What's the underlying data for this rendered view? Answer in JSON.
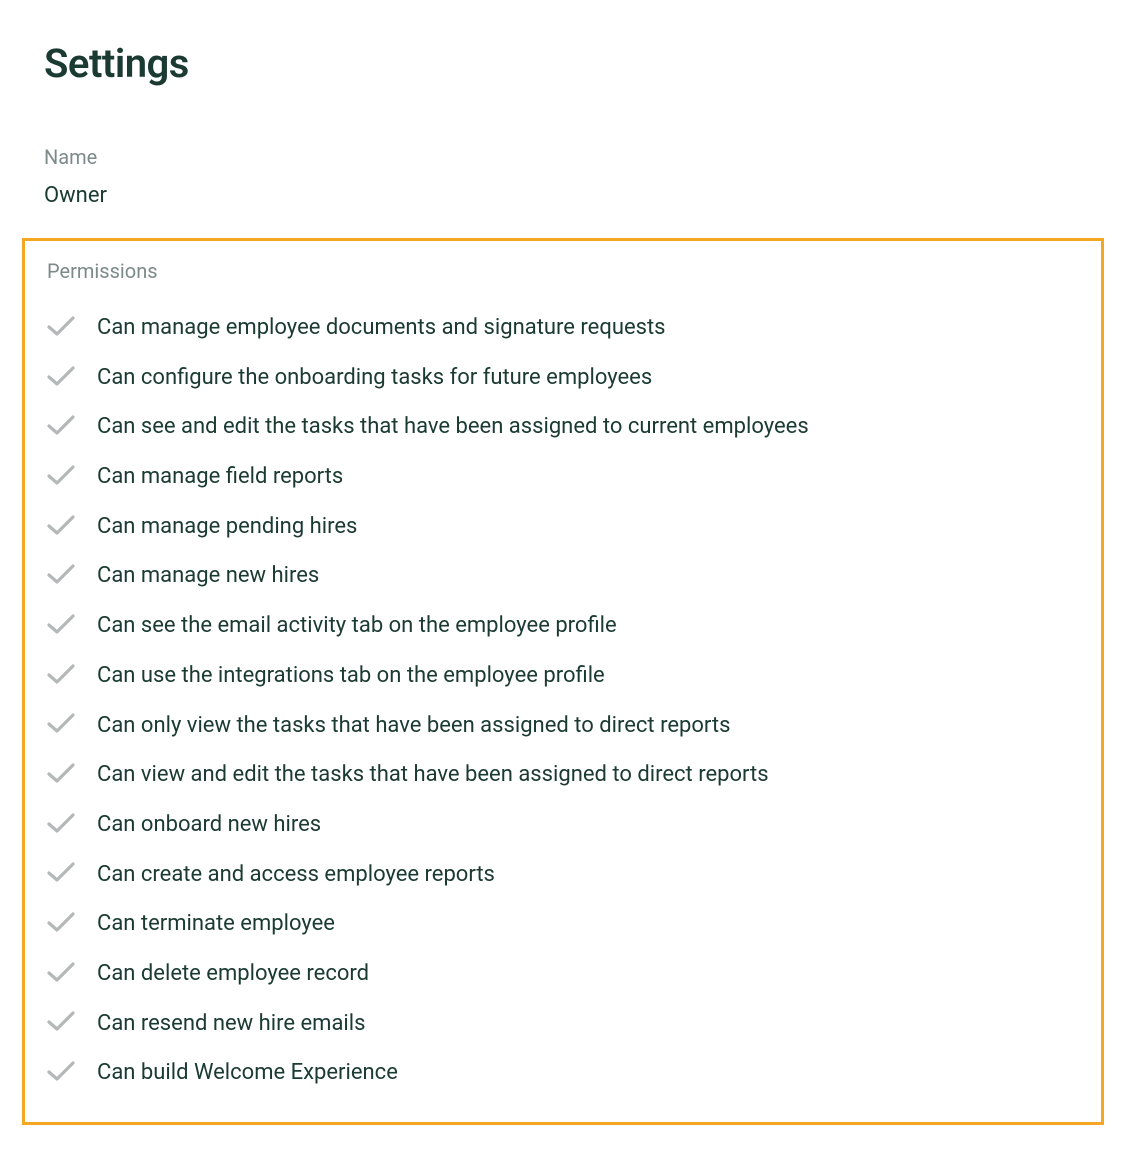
{
  "header": {
    "title": "Settings"
  },
  "name_field": {
    "label": "Name",
    "value": "Owner"
  },
  "permissions": {
    "label": "Permissions",
    "items": [
      "Can manage employee documents and signature requests",
      "Can configure the onboarding tasks for future employees",
      "Can see and edit the tasks that have been assigned to current employees",
      "Can manage field reports",
      "Can manage pending hires",
      "Can manage new hires",
      "Can see the email activity tab on the employee profile",
      "Can use the integrations tab on the employee profile",
      "Can only view the tasks that have been assigned to direct reports",
      "Can view and edit the tasks that have been assigned to direct reports",
      "Can onboard new hires",
      "Can create and access employee reports",
      "Can terminate employee",
      "Can delete employee record",
      "Can resend new hire emails",
      "Can build Welcome Experience"
    ]
  },
  "colors": {
    "highlight_border": "#f5a623",
    "text_primary": "#1a3a32",
    "text_muted": "#7d8a8a",
    "check_icon": "#b5b8b8"
  }
}
